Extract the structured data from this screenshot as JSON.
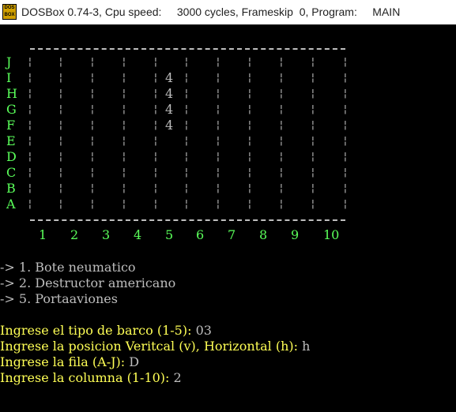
{
  "window": {
    "title": "DOSBox 0.74-3, Cpu speed:     3000 cycles, Frameskip  0, Program:     MAIN",
    "icon": "dosbox-icon",
    "icon_text": "DOS BOX"
  },
  "board": {
    "rows": [
      "J",
      "I",
      "H",
      "G",
      "F",
      "E",
      "D",
      "C",
      "B",
      "A"
    ],
    "columns": [
      "1",
      "2",
      "3",
      "4",
      "5",
      "6",
      "7",
      "8",
      "9",
      "10"
    ],
    "ships": [
      {
        "row": "I",
        "col": "5",
        "value": "4"
      },
      {
        "row": "H",
        "col": "5",
        "value": "4"
      },
      {
        "row": "G",
        "col": "5",
        "value": "4"
      },
      {
        "row": "F",
        "col": "5",
        "value": "4"
      }
    ]
  },
  "menu": [
    "-> 1. Bote neumatico",
    "-> 2. Destructor americano",
    "-> 5. Portaaviones"
  ],
  "prompts": [
    {
      "label": "Ingrese el tipo de barco (1-5): ",
      "value": "03"
    },
    {
      "label": "Ingrese la posicion Veritcal (v), Horizontal (h): ",
      "value": "h"
    },
    {
      "label": "Ingrese la fila (A-J): ",
      "value": "D"
    },
    {
      "label": "Ingrese la columna (1-10): ",
      "value": "2"
    }
  ],
  "colors": {
    "axis": "#5aff5a",
    "grid": "#bdbdbd",
    "prompt": "#ffff55",
    "background": "#000000"
  }
}
